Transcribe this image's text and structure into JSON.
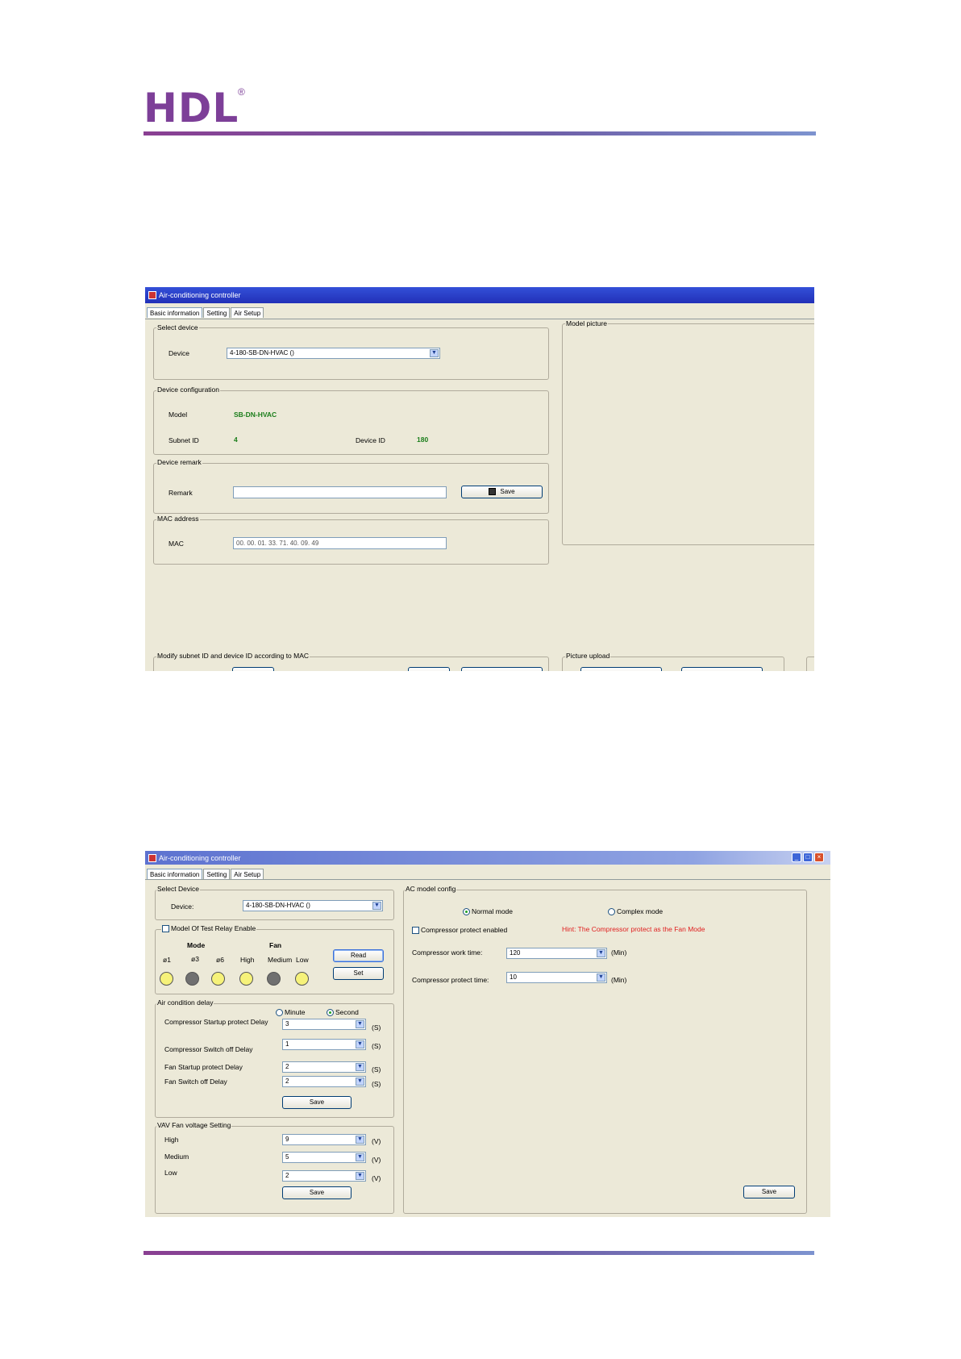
{
  "brand": {
    "logo": "HDL",
    "reg": "®"
  },
  "win1": {
    "title": "Air-conditioning controller",
    "tabs": [
      "Basic information",
      "Setting",
      "Air Setup"
    ],
    "select_device": {
      "legend": "Select device",
      "label": "Device",
      "value": "4-180-SB-DN-HVAC ()"
    },
    "config": {
      "legend": "Device configuration",
      "model_label": "Model",
      "model_value": "SB-DN-HVAC",
      "subnet_label": "Subnet ID",
      "subnet_value": "4",
      "device_id_label": "Device ID",
      "device_id_value": "180"
    },
    "remark": {
      "legend": "Device remark",
      "label": "Remark",
      "value": "",
      "save": "Save"
    },
    "mac": {
      "legend": "MAC address",
      "label": "MAC",
      "value": "00. 00. 01. 33. 71. 40. 09. 49"
    },
    "model_picture": {
      "legend": "Model picture"
    },
    "modify": {
      "legend": "Modify subnet ID and device ID according to MAC"
    },
    "upload": {
      "legend": "Picture upload"
    }
  },
  "win2": {
    "title": "Air-conditioning controller",
    "tabs": [
      "Basic information",
      "Setting",
      "Air Setup"
    ],
    "select_device": {
      "legend": "Select Device",
      "label": "Device:",
      "value": "4-180-SB-DN-HVAC ()"
    },
    "relay": {
      "legend": "Model Of Test Relay Enable",
      "mode_header": "Mode",
      "fan_header": "Fan",
      "labels": [
        "ø1",
        "ø3",
        "ø6",
        "High",
        "Medium",
        "Low"
      ],
      "read": "Read",
      "set": "Set",
      "leds": [
        {
          "color": "#f6f27a"
        },
        {
          "color": "#707070"
        },
        {
          "color": "#f6f27a"
        },
        {
          "color": "#f6f27a"
        },
        {
          "color": "#707070"
        },
        {
          "color": "#f6f27a"
        }
      ]
    },
    "delay": {
      "legend": "Air condition delay",
      "minute": "Minute",
      "second": "Second",
      "rows": [
        {
          "label": "Compressor Startup protect Delay",
          "value": "3",
          "unit": "(S)"
        },
        {
          "label": "Compressor Switch off Delay",
          "value": "1",
          "unit": "(S)"
        },
        {
          "label": "Fan Startup protect  Delay",
          "value": "2",
          "unit": "(S)"
        },
        {
          "label": "Fan Switch off Delay",
          "value": "2",
          "unit": "(S)"
        }
      ],
      "save": "Save"
    },
    "vav": {
      "legend": "VAV Fan voltage Setting",
      "rows": [
        {
          "label": "High",
          "value": "9",
          "unit": "(V)"
        },
        {
          "label": "Medium",
          "value": "5",
          "unit": "(V)"
        },
        {
          "label": "Low",
          "value": "2",
          "unit": "(V)"
        }
      ],
      "save": "Save"
    },
    "ac": {
      "legend": "AC model config",
      "normal": "Normal mode",
      "complex": "Complex mode",
      "protect_enabled": "Compressor protect enabled",
      "hint": "Hint: The Compressor protect as the Fan Mode",
      "work_label": "Compressor work time:",
      "work_value": "120",
      "work_unit": "(Min)",
      "protect_label": "Compressor protect time:",
      "protect_value": "10",
      "protect_unit": "(Min)",
      "save": "Save"
    }
  },
  "colors": {
    "brand": "#7d3f98",
    "titlebar1": "#2a3fc8",
    "titlebar2": "#7891d8",
    "window_bg": "#ece9d8",
    "hint": "#e02020",
    "value_green": "#1a7d1a"
  }
}
